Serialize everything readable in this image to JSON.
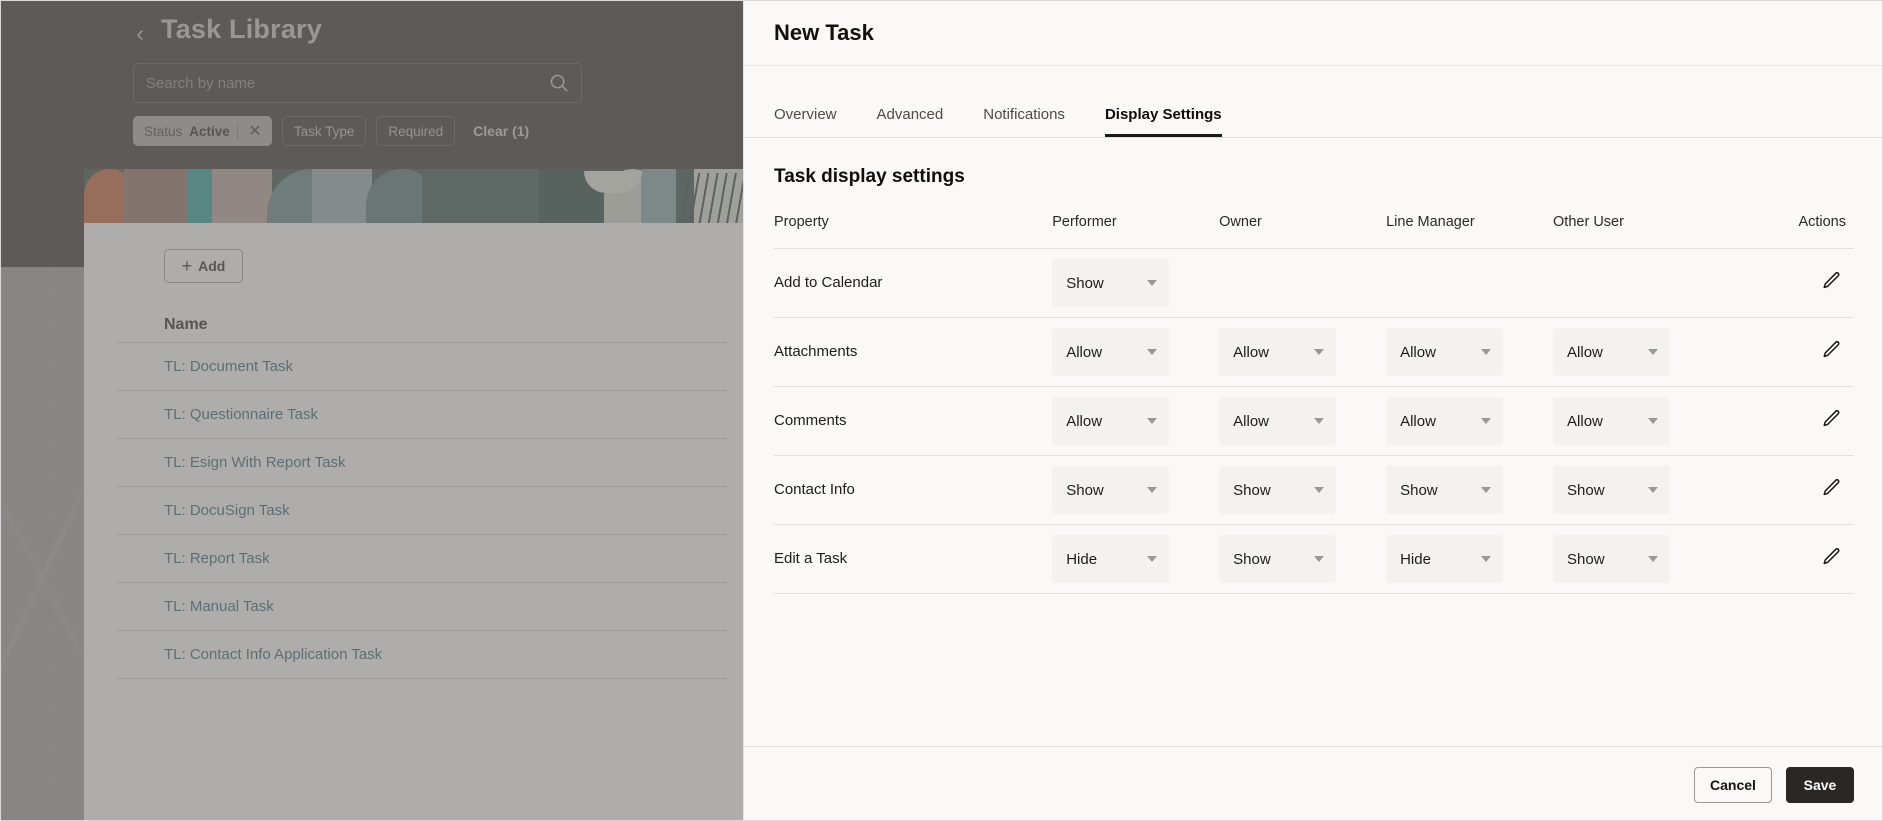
{
  "background_app": {
    "back_icon": "chevron-left-icon",
    "title": "Task Library",
    "search": {
      "placeholder": "Search by name",
      "value": "",
      "icon": "search-icon"
    },
    "filters": {
      "active_pill": {
        "key": "Status",
        "value": "Active",
        "remove_icon": "close-icon"
      },
      "pills": [
        "Task Type",
        "Required"
      ],
      "clear_label": "Clear (1)"
    },
    "add_button": {
      "label": "Add",
      "icon": "plus-icon"
    },
    "table": {
      "columns": [
        "Name"
      ],
      "rows": [
        "TL: Document Task",
        "TL: Questionnaire Task",
        "TL: Esign With Report Task",
        "TL: DocuSign Task",
        "TL: Report Task",
        "TL: Manual Task",
        "TL: Contact Info Application Task"
      ]
    }
  },
  "drawer": {
    "title": "New Task",
    "tabs": [
      {
        "label": "Overview",
        "selected": false
      },
      {
        "label": "Advanced",
        "selected": false
      },
      {
        "label": "Notifications",
        "selected": false
      },
      {
        "label": "Display Settings",
        "selected": true
      }
    ],
    "section_title": "Task display settings",
    "table": {
      "headers": [
        "Property",
        "Performer",
        "Owner",
        "Line Manager",
        "Other User",
        "Actions"
      ],
      "rows": [
        {
          "property": "Add to Calendar",
          "performer": "Show",
          "owner": "",
          "line_manager": "",
          "other_user": "",
          "action_icon": "edit-pencil-icon"
        },
        {
          "property": "Attachments",
          "performer": "Allow",
          "owner": "Allow",
          "line_manager": "Allow",
          "other_user": "Allow",
          "action_icon": "edit-pencil-icon"
        },
        {
          "property": "Comments",
          "performer": "Allow",
          "owner": "Allow",
          "line_manager": "Allow",
          "other_user": "Allow",
          "action_icon": "edit-pencil-icon"
        },
        {
          "property": "Contact Info",
          "performer": "Show",
          "owner": "Show",
          "line_manager": "Show",
          "other_user": "Show",
          "action_icon": "edit-pencil-icon"
        },
        {
          "property": "Edit a Task",
          "performer": "Hide",
          "owner": "Show",
          "line_manager": "Hide",
          "other_user": "Show",
          "action_icon": "edit-pencil-icon"
        }
      ]
    },
    "footer": {
      "cancel_label": "Cancel",
      "save_label": "Save"
    }
  },
  "colors": {
    "dark_header": "#2a2623",
    "drawer_bg": "#faf9f7",
    "link": "#2b5a6b",
    "save_bg": "#2b2724",
    "tab_underline": "#1a1a1a"
  }
}
